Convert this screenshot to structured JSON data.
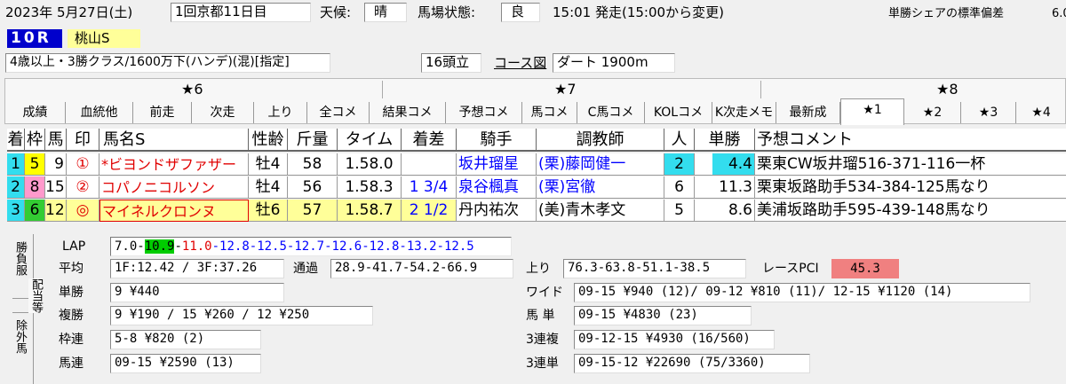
{
  "header": {
    "date": "2023年  5月27日(土)",
    "meeting": "1回京都11日目",
    "weather_label": "天候:",
    "weather": "晴",
    "track_label": "馬場状態:",
    "track": "良",
    "time": "15:01 発走(15:00から変更)",
    "stddev_label": "単勝シェアの標準偏差",
    "stddev_value": "6.0",
    "race_no": "10R",
    "race_name": "桃山S",
    "conditions": "4歳以上・3勝クラス/1600万下(ハンデ)(混)[指定]",
    "field_size": "16頭立",
    "course_link": "コース図",
    "course": "ダート  1900m"
  },
  "tabs": {
    "stars": [
      "★6",
      "★7",
      "★8"
    ],
    "items": [
      "成績",
      "血統他",
      "前走",
      "次走",
      "上り",
      "全コメ",
      "結果コメ",
      "予想コメ",
      "馬コメ",
      "C馬コメ",
      "KOLコメ",
      "K次走メモ",
      "最新成",
      "★1",
      "★2",
      "★3",
      "★4"
    ],
    "active_index": 13
  },
  "table": {
    "headers": [
      "着",
      "枠",
      "馬",
      "印",
      "馬名S",
      "性齢",
      "斤量",
      "タイム",
      "着差",
      "騎手",
      "調教師",
      "人",
      "単勝",
      "予想コメント"
    ],
    "rows": [
      {
        "rank": "1",
        "waku": "5",
        "num": "9",
        "mark": "①",
        "name": "*ビヨンドザファザー",
        "sexage": "牡4",
        "weight": "58",
        "time": "1.58.0",
        "margin": "",
        "jockey": "坂井瑠星",
        "trainer": "(栗)藤岡健一",
        "pop": "2",
        "odds": "4.4",
        "comment": "栗東CW坂井瑠516-371-116一杯"
      },
      {
        "rank": "2",
        "waku": "8",
        "num": "15",
        "mark": "②",
        "name": "コパノニコルソン",
        "sexage": "牡4",
        "weight": "56",
        "time": "1.58.3",
        "margin": "1 3/4",
        "jockey": "泉谷楓真",
        "trainer": "(栗)宮徹",
        "pop": "6",
        "odds": "11.3",
        "comment": "栗東坂路助手534-384-125馬なり"
      },
      {
        "rank": "3",
        "waku": "6",
        "num": "12",
        "mark": "◎",
        "name": "マイネルクロンヌ",
        "sexage": "牡6",
        "weight": "57",
        "time": "1.58.7",
        "margin": "2 1/2",
        "jockey": "丹内祐次",
        "trainer": "(美)青木孝文",
        "pop": "5",
        "odds": "8.6",
        "comment": "美浦坂路助手595-439-148馬なり"
      }
    ]
  },
  "side_tabs": [
    "勝負服",
    "配当等",
    "除外馬"
  ],
  "result": {
    "lap_label": "LAP",
    "laps": [
      "7.0",
      "10.9",
      "11.0",
      "12.8",
      "12.5",
      "12.7",
      "12.6",
      "12.8",
      "13.2",
      "12.5"
    ],
    "avg_label": "平均",
    "avg": "1F:12.42 / 3F:37.26",
    "passing_label": "通過",
    "passing": "28.9-41.7-54.2-66.9",
    "last_label": "上り",
    "last": "76.3-63.8-51.1-38.5",
    "pci_label": "レースPCI",
    "pci": "45.3",
    "win_label": "単勝",
    "win": " 9 ¥440",
    "place_label": "複勝",
    "place": " 9 ¥190 / 15 ¥260 / 12 ¥250",
    "bracket_label": "枠連",
    "bracket": "5-8 ¥820 (2)",
    "quinella_label": "馬連",
    "quinella": "09-15 ¥2590 (13)",
    "wide_label": "ワイド",
    "wide": "09-15 ¥940 (12)/ 09-12 ¥810 (11)/ 12-15 ¥1120 (14)",
    "exacta_label": "馬 単",
    "exacta": "09-15 ¥4830 (23)",
    "trio_label": "3連複",
    "trio": "09-12-15 ¥4930 (16/560)",
    "trifecta_label": "3連単",
    "trifecta": "09-15-12 ¥22690 (75/3360)"
  },
  "colors": {
    "race_no_bg": "#0000cc",
    "race_name_bg": "#ffff99",
    "waku5": "#ffff00",
    "waku8": "#ff99cc",
    "waku6": "#33cc33",
    "row3_bg": "#ffff99",
    "pop2_bg": "#33ddee",
    "odds_bg": "#33ddee",
    "lap_fast": "#00cc00",
    "pci_bg": "#f08080"
  }
}
